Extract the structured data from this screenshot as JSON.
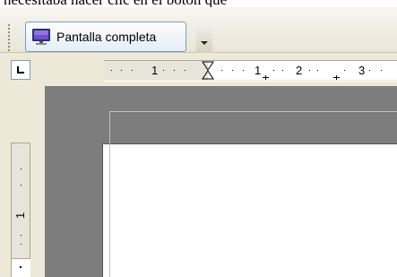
{
  "background_text": "necesitaba hacer clic en el botón que",
  "toolbar": {
    "fullscreen_label": "Pantalla completa"
  },
  "ruler": {
    "h_labels": [
      "1",
      "1",
      "2",
      "3"
    ],
    "v_labels": [
      "1"
    ]
  },
  "colors": {
    "toolbar_bg": "#ece9d8",
    "workspace_gray": "#7d7d7d",
    "page_white": "#ffffff",
    "button_border": "#7b9ac8"
  }
}
